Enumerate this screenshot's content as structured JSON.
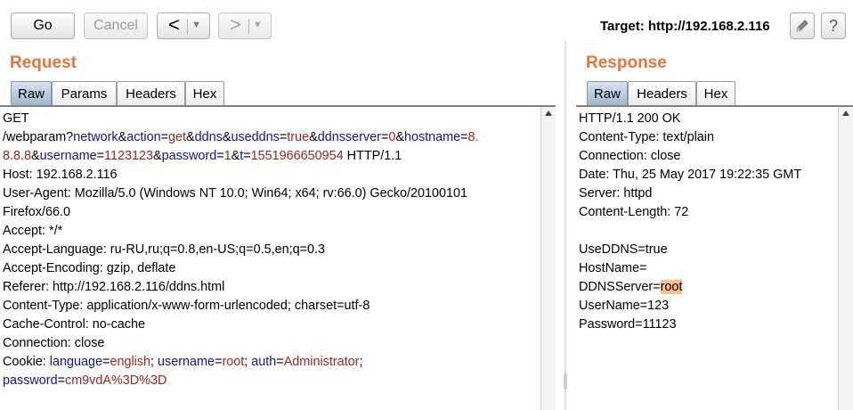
{
  "toolbar": {
    "go_label": "Go",
    "cancel_label": "Cancel",
    "back_glyph": "<",
    "forward_glyph": ">",
    "dropdown_glyph": "▼",
    "target_label": "Target: http://192.168.2.116",
    "help_glyph": "?"
  },
  "request": {
    "title": "Request",
    "tabs": [
      "Raw",
      "Params",
      "Headers",
      "Hex"
    ],
    "active_tab": "Raw",
    "lines": [
      [
        {
          "t": "GET"
        }
      ],
      [
        {
          "t": "/webparam?"
        },
        {
          "t": "network",
          "c": "pn"
        },
        {
          "t": "&"
        },
        {
          "t": "action",
          "c": "pn"
        },
        {
          "t": "="
        },
        {
          "t": "get",
          "c": "pv"
        },
        {
          "t": "&"
        },
        {
          "t": "ddns",
          "c": "pn"
        },
        {
          "t": "&"
        },
        {
          "t": "useddns",
          "c": "pn"
        },
        {
          "t": "="
        },
        {
          "t": "true",
          "c": "pv"
        },
        {
          "t": "&"
        },
        {
          "t": "ddnsserver",
          "c": "pn"
        },
        {
          "t": "="
        },
        {
          "t": "0",
          "c": "pv"
        },
        {
          "t": "&"
        },
        {
          "t": "hostname",
          "c": "pn"
        },
        {
          "t": "="
        },
        {
          "t": "8.",
          "c": "pv"
        }
      ],
      [
        {
          "t": "8.8.8",
          "c": "pv"
        },
        {
          "t": "&"
        },
        {
          "t": "username",
          "c": "pn"
        },
        {
          "t": "="
        },
        {
          "t": "1123123",
          "c": "pv"
        },
        {
          "t": "&"
        },
        {
          "t": "password",
          "c": "pn"
        },
        {
          "t": "="
        },
        {
          "t": "1",
          "c": "pv"
        },
        {
          "t": "&"
        },
        {
          "t": "t",
          "c": "pn"
        },
        {
          "t": "="
        },
        {
          "t": "1551966650954",
          "c": "pv"
        },
        {
          "t": " HTTP/1.1"
        }
      ],
      [
        {
          "t": "Host: 192.168.2.116"
        }
      ],
      [
        {
          "t": "User-Agent: Mozilla/5.0 (Windows NT 10.0; Win64; x64; rv:66.0) Gecko/20100101"
        }
      ],
      [
        {
          "t": "Firefox/66.0"
        }
      ],
      [
        {
          "t": "Accept: */*"
        }
      ],
      [
        {
          "t": "Accept-Language: ru-RU,ru;q=0.8,en-US;q=0.5,en;q=0.3"
        }
      ],
      [
        {
          "t": "Accept-Encoding: gzip, deflate"
        }
      ],
      [
        {
          "t": "Referer: http://192.168.2.116/ddns.html"
        }
      ],
      [
        {
          "t": "Content-Type: application/x-www-form-urlencoded; charset=utf-8"
        }
      ],
      [
        {
          "t": "Cache-Control: no-cache"
        }
      ],
      [
        {
          "t": "Connection: close"
        }
      ],
      [
        {
          "t": "Cookie: "
        },
        {
          "t": "language",
          "c": "pn"
        },
        {
          "t": "="
        },
        {
          "t": "english",
          "c": "pv"
        },
        {
          "t": "; "
        },
        {
          "t": "username",
          "c": "pn"
        },
        {
          "t": "="
        },
        {
          "t": "root",
          "c": "pv"
        },
        {
          "t": "; "
        },
        {
          "t": "auth",
          "c": "pn"
        },
        {
          "t": "="
        },
        {
          "t": "Administrator",
          "c": "pv"
        },
        {
          "t": ";"
        }
      ],
      [
        {
          "t": "password",
          "c": "pn"
        },
        {
          "t": "="
        },
        {
          "t": "cm9vdA%3D%3D",
          "c": "pv"
        }
      ]
    ]
  },
  "response": {
    "title": "Response",
    "tabs": [
      "Raw",
      "Headers",
      "Hex"
    ],
    "active_tab": "Raw",
    "lines": [
      [
        {
          "t": "HTTP/1.1 200 OK"
        }
      ],
      [
        {
          "t": "Content-Type: text/plain"
        }
      ],
      [
        {
          "t": "Connection: close"
        }
      ],
      [
        {
          "t": "Date: Thu, 25 May 2017 19:22:35 GMT"
        }
      ],
      [
        {
          "t": "Server: httpd"
        }
      ],
      [
        {
          "t": "Content-Length: 72"
        }
      ],
      [
        {
          "t": ""
        }
      ],
      [
        {
          "t": "UseDDNS=true"
        }
      ],
      [
        {
          "t": "HostName="
        }
      ],
      [
        {
          "t": "DDNSServer="
        },
        {
          "t": "root",
          "c": "hl"
        }
      ],
      [
        {
          "t": "UserName=123"
        }
      ],
      [
        {
          "t": "Password=11123"
        }
      ]
    ]
  },
  "colors": {
    "panel_title": "#e8743b",
    "param_name": "#12129a",
    "param_value": "#a02323",
    "highlight": "#fbbf91"
  }
}
